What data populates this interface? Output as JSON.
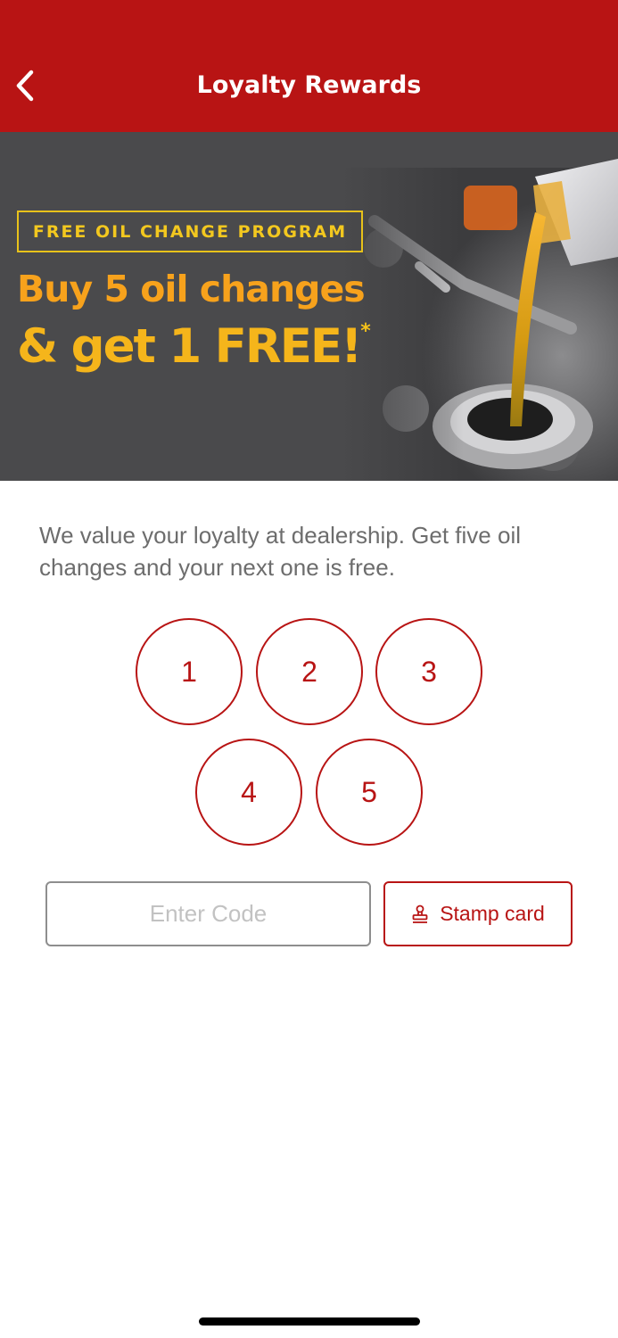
{
  "header": {
    "title": "Loyalty Rewards",
    "back_icon": "chevron-left-icon",
    "background_color": "#b81414"
  },
  "banner": {
    "program_label": "FREE OIL CHANGE PROGRAM",
    "headline_line1": "Buy 5 oil changes",
    "headline_line2": "& get 1 FREE!",
    "asterisk": "*",
    "image": "oil-pouring-engine-photo"
  },
  "description": "We value your loyalty at dealership. Get five oil changes and your next one is free.",
  "stamps": [
    "1",
    "2",
    "3",
    "4",
    "5"
  ],
  "code_input": {
    "placeholder": "Enter Code",
    "value": ""
  },
  "stamp_button": {
    "label": "Stamp card",
    "icon": "stamp-icon"
  },
  "colors": {
    "accent": "#b81414",
    "banner_bg": "#4a4a4c",
    "banner_text": "#f5b51b"
  }
}
